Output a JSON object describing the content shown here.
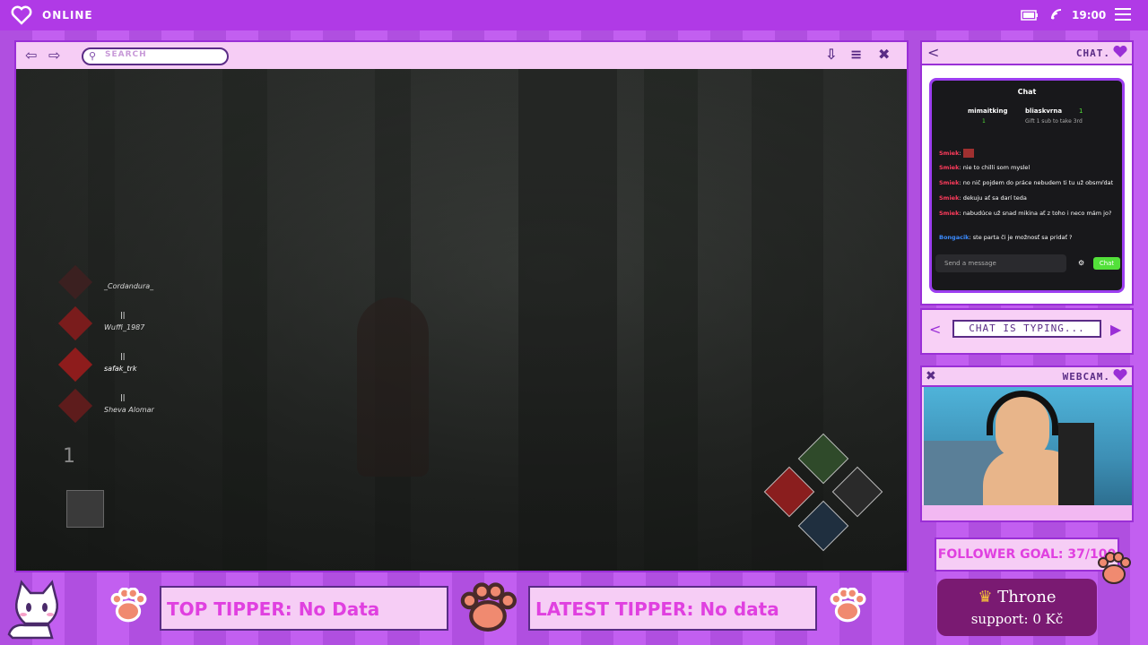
{
  "topbar": {
    "status": "ONLINE",
    "clock": "19:00"
  },
  "browser": {
    "search_placeholder": "SEARCH"
  },
  "game_hud": {
    "survivors": [
      {
        "name": "_Cordandura_"
      },
      {
        "name": "Wuffi_1987"
      },
      {
        "name": "safak_trk"
      },
      {
        "name": "Sheva Alomar"
      }
    ],
    "item_count": "1"
  },
  "chat": {
    "panel_title": "CHAT.",
    "window_title": "Chat",
    "gift_left_user": "mimaitking",
    "gift_left_count": "1",
    "gift_right_user": "bliaskvrna",
    "gift_right_count": "1",
    "gift_note": "Gift 1 sub to take 3rd",
    "messages": [
      {
        "user": "Smiek",
        "text": ""
      },
      {
        "user": "Smiek",
        "text": "nie to chilli som myslel"
      },
      {
        "user": "Smiek",
        "text": "no nič pojdem do práce nebudem ti tu už obsmŕdat"
      },
      {
        "user": "Smiek",
        "text": "dekuju ať sa darí teda"
      },
      {
        "user": "Smiek",
        "text": "nabudúce už snad mikina ať z toho i neco mám jo?"
      },
      {
        "user": "Bongacik",
        "text": "ste parta či je možnosť sa pridať ?"
      }
    ],
    "input_placeholder": "Send a message",
    "send_label": "Chat"
  },
  "typing": {
    "text": "CHAT IS TYPING..."
  },
  "webcam": {
    "panel_title": "WEBCAM."
  },
  "goal": {
    "text": "FOLLOWER GOAL: 37/100"
  },
  "throne": {
    "line1": "Throne",
    "line2": "support: 0 Kč"
  },
  "tippers": {
    "top": "TOP TIPPER: No Data",
    "latest": "LATEST TIPPER: No data"
  },
  "colors": {
    "accent": "#b03ae6",
    "panel": "#f8d0f6",
    "pink_text": "#e040e0",
    "dark_purple": "#5a2c86"
  }
}
